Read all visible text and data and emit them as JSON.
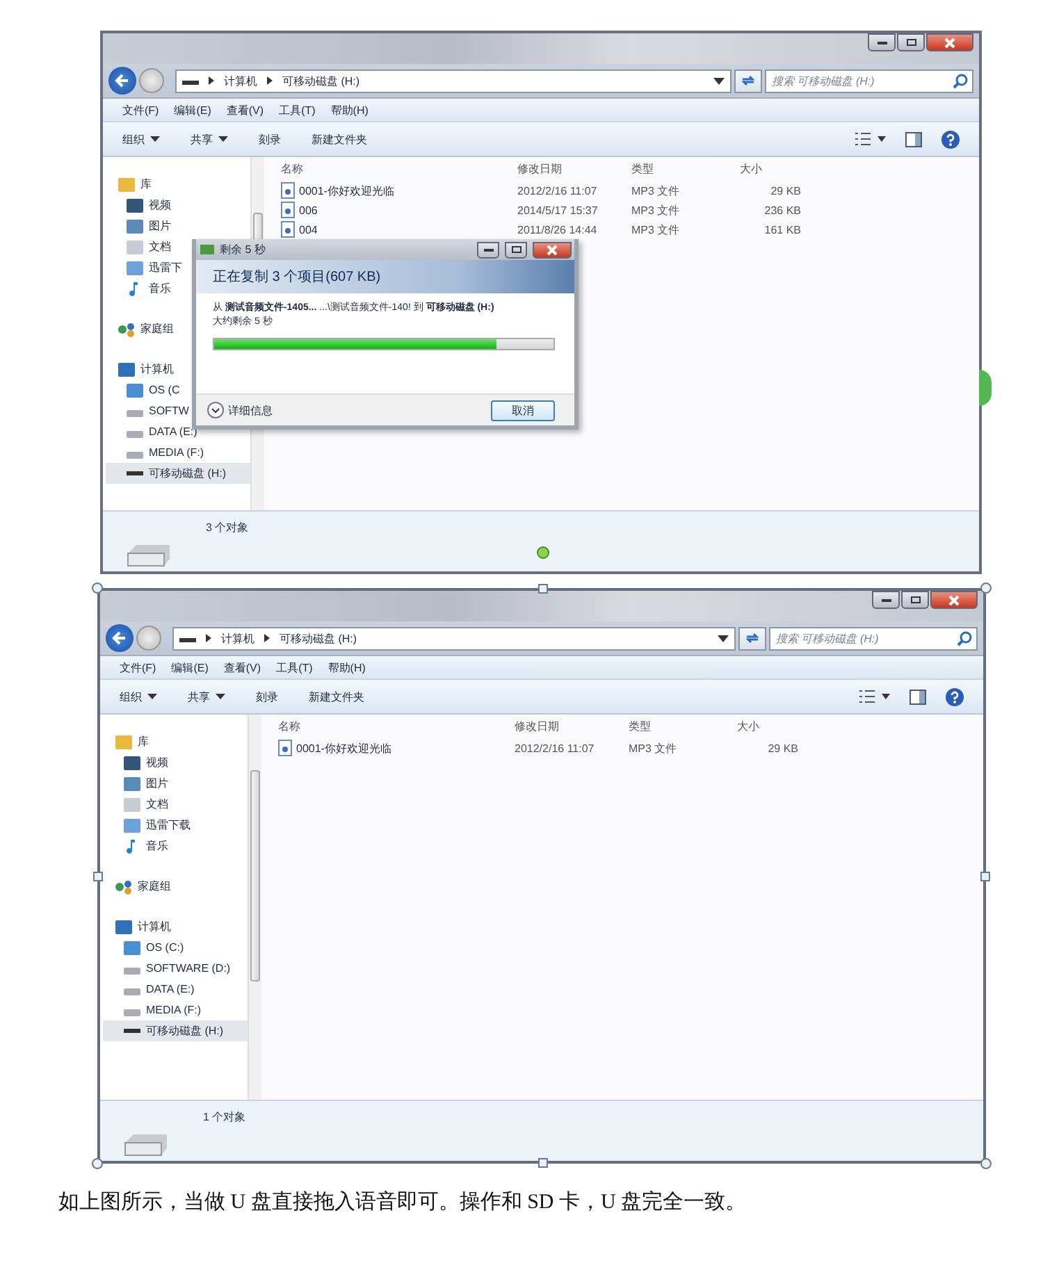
{
  "screenshots": [
    {
      "breadcrumb": [
        "计算机",
        "可移动磁盘 (H:)"
      ],
      "search_placeholder": "搜索 可移动磁盘 (H:)",
      "menu": [
        "文件(F)",
        "编辑(E)",
        "查看(V)",
        "工具(T)",
        "帮助(H)"
      ],
      "toolbar": [
        {
          "label": "组织",
          "has_menu": true
        },
        {
          "label": "共享",
          "has_menu": true
        },
        {
          "label": "刻录",
          "has_menu": false
        },
        {
          "label": "新建文件夹",
          "has_menu": false
        }
      ],
      "columns": [
        "名称",
        "修改日期",
        "类型",
        "大小"
      ],
      "files": [
        {
          "name": "0001-你好欢迎光临",
          "date": "2012/2/16 11:07",
          "type": "MP3 文件",
          "size": "29 KB"
        },
        {
          "name": "006",
          "date": "2014/5/17 15:37",
          "type": "MP3 文件",
          "size": "236 KB"
        },
        {
          "name": "004",
          "date": "2011/8/26 14:44",
          "type": "MP3 文件",
          "size": "161 KB"
        }
      ],
      "nav": [
        {
          "label": "库",
          "kind": "library",
          "selected": false,
          "children": [
            {
              "label": "视频",
              "kind": "video",
              "selected": false
            },
            {
              "label": "图片",
              "kind": "picture",
              "selected": false
            },
            {
              "label": "文档",
              "kind": "document",
              "selected": false
            },
            {
              "label": "迅雷下",
              "kind": "download",
              "selected": false
            },
            {
              "label": "音乐",
              "kind": "music",
              "selected": false
            }
          ]
        },
        {
          "label": "家庭组",
          "kind": "homegroup",
          "selected": false
        },
        {
          "label": "计算机",
          "kind": "computer",
          "selected": false,
          "children": [
            {
              "label": "OS (C",
              "kind": "os",
              "selected": false
            },
            {
              "label": "SOFTW",
              "kind": "drive",
              "selected": false
            },
            {
              "label": "DATA (E:)",
              "kind": "drive",
              "selected": false
            },
            {
              "label": "MEDIA (F:)",
              "kind": "drive",
              "selected": false
            },
            {
              "label": "可移动磁盘 (H:)",
              "kind": "usb",
              "selected": true
            }
          ]
        }
      ],
      "status": "3 个对象",
      "selected_in_document": false,
      "dialog": {
        "title": "剩余 5 秒",
        "header": "正在复制 3 个项目(607 KB)",
        "from_line": "从 **测试音频文件-1405...** ...\\测试音频文件-140! 到 **可移动磁盘 (H:)**",
        "remaining": "大约剩余 5 秒",
        "level": 0.83,
        "details": "详细信息",
        "cancel": "取消"
      }
    },
    {
      "breadcrumb": [
        "计算机",
        "可移动磁盘 (H:)"
      ],
      "search_placeholder": "搜索 可移动磁盘 (H:)",
      "menu": [
        "文件(F)",
        "编辑(E)",
        "查看(V)",
        "工具(T)",
        "帮助(H)"
      ],
      "toolbar": [
        {
          "label": "组织",
          "has_menu": true
        },
        {
          "label": "共享",
          "has_menu": true
        },
        {
          "label": "刻录",
          "has_menu": false
        },
        {
          "label": "新建文件夹",
          "has_menu": false
        }
      ],
      "columns": [
        "名称",
        "修改日期",
        "类型",
        "大小"
      ],
      "files": [
        {
          "name": "0001-你好欢迎光临",
          "date": "2012/2/16 11:07",
          "type": "MP3 文件",
          "size": "29 KB"
        }
      ],
      "nav": [
        {
          "label": "库",
          "kind": "library",
          "selected": false,
          "children": [
            {
              "label": "视频",
              "kind": "video",
              "selected": false
            },
            {
              "label": "图片",
              "kind": "picture",
              "selected": false
            },
            {
              "label": "文档",
              "kind": "document",
              "selected": false
            },
            {
              "label": "迅雷下载",
              "kind": "download",
              "selected": false
            },
            {
              "label": "音乐",
              "kind": "music",
              "selected": false
            }
          ]
        },
        {
          "label": "家庭组",
          "kind": "homegroup",
          "selected": false
        },
        {
          "label": "计算机",
          "kind": "computer",
          "selected": false,
          "children": [
            {
              "label": "OS (C:)",
              "kind": "os",
              "selected": false
            },
            {
              "label": "SOFTWARE (D:)",
              "kind": "drive",
              "selected": false
            },
            {
              "label": "DATA (E:)",
              "kind": "drive",
              "selected": false
            },
            {
              "label": "MEDIA (F:)",
              "kind": "drive",
              "selected": false
            },
            {
              "label": "可移动磁盘 (H:)",
              "kind": "usb",
              "selected": true
            }
          ]
        }
      ],
      "status": "1 个对象",
      "selected_in_document": true
    }
  ],
  "caption": "如上图所示，当做 U 盘直接拖入语音即可。操作和 SD 卡，U 盘完全一致。"
}
